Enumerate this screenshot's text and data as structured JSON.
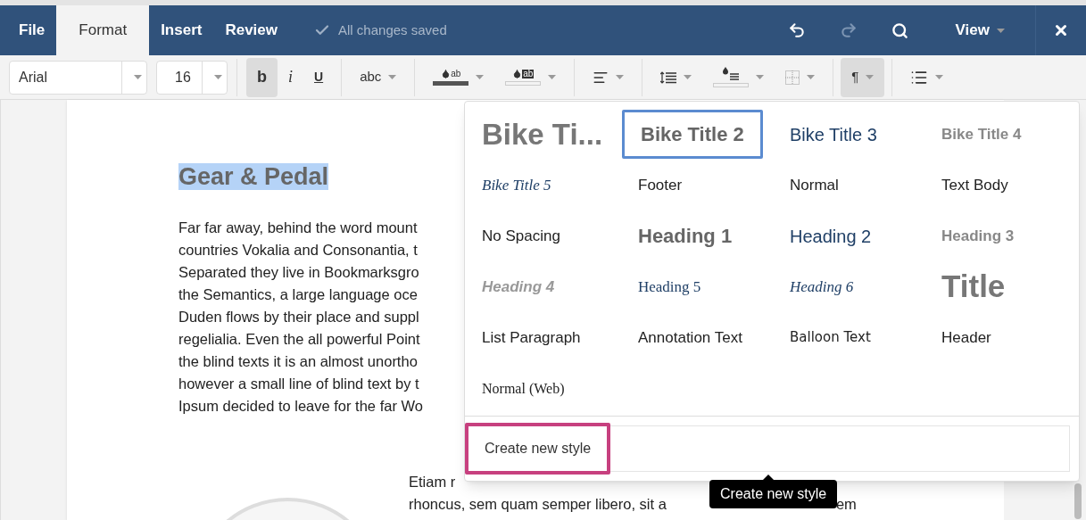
{
  "menu_tabs": [
    {
      "label": "File",
      "selected": false
    },
    {
      "label": "Format",
      "selected": true
    },
    {
      "label": "Insert",
      "selected": false
    },
    {
      "label": "Review",
      "selected": false
    }
  ],
  "save_status": "All changes saved",
  "top_actions": [
    {
      "kind": "undo",
      "disabled": false
    },
    {
      "kind": "redo",
      "disabled": true
    },
    {
      "kind": "search",
      "disabled": false
    }
  ],
  "view_menu": "View",
  "toolbar": {
    "font": "Arial",
    "size": "16",
    "buttons": [
      {
        "kind": "bold",
        "label": "b",
        "active": true,
        "dropdown": false
      },
      {
        "kind": "italic",
        "label": "i",
        "active": false,
        "dropdown": false
      },
      {
        "kind": "underline",
        "label": "U",
        "active": false,
        "dropdown": false
      },
      {
        "kind": "text",
        "label": "abc",
        "active": false,
        "dropdown": true
      },
      {
        "kind": "font-color",
        "label": "ab",
        "active": false,
        "dropdown": true
      },
      {
        "kind": "highlight",
        "label": "ab",
        "active": false,
        "dropdown": true
      },
      {
        "kind": "align",
        "active": false,
        "dropdown": true
      },
      {
        "kind": "line-spacing",
        "active": false,
        "dropdown": true
      },
      {
        "kind": "shading",
        "active": false,
        "dropdown": true
      },
      {
        "kind": "borders",
        "active": false,
        "dropdown": true
      },
      {
        "kind": "text",
        "label": "¶",
        "active": true,
        "dropdown": true
      },
      {
        "kind": "list",
        "active": false,
        "dropdown": true
      }
    ]
  },
  "document": {
    "heading": "Gear & Pedal",
    "paragraph": [
      "Far far away, behind the word mount",
      "countries Vokalia and Consonantia, t",
      "Separated they live in Bookmarksgro",
      "the Semantics, a large language oce",
      "Duden flows by their place and suppl",
      "regelialia. Even the all powerful Point",
      "the blind texts it is an almost unortho",
      "however a small line of blind text by t",
      "Ipsum decided to leave for the far Wo"
    ],
    "paragraph_2": [
      "Etiam r",
      "rhoncus, sem quam semper libero, sit a"
    ],
    "paragraph_2_tail": "em"
  },
  "styles_menu": {
    "items": [
      {
        "label": "Bike Ti...",
        "kind": "bike-title-1",
        "selected": false
      },
      {
        "label": "Bike Title 2",
        "kind": "bike-title-2",
        "selected": true
      },
      {
        "label": "Bike Title 3",
        "kind": "bike-title-3",
        "selected": false
      },
      {
        "label": "Bike Title 4",
        "kind": "bike-title-4",
        "selected": false
      },
      {
        "label": "Bike Title 5",
        "kind": "bike-title-5",
        "selected": false
      },
      {
        "label": "Footer",
        "kind": "plain",
        "selected": false
      },
      {
        "label": "Normal",
        "kind": "plain",
        "selected": false
      },
      {
        "label": "Text Body",
        "kind": "plain",
        "selected": false
      },
      {
        "label": "No Spacing",
        "kind": "plain",
        "selected": false
      },
      {
        "label": "Heading 1",
        "kind": "heading-1",
        "selected": false
      },
      {
        "label": "Heading 2",
        "kind": "heading-2",
        "selected": false
      },
      {
        "label": "Heading 3",
        "kind": "heading-3",
        "selected": false
      },
      {
        "label": "Heading 4",
        "kind": "heading-4",
        "selected": false
      },
      {
        "label": "Heading 5",
        "kind": "heading-5",
        "selected": false
      },
      {
        "label": "Heading 6",
        "kind": "heading-6",
        "selected": false
      },
      {
        "label": "Title",
        "kind": "title",
        "selected": false
      },
      {
        "label": "List Paragraph",
        "kind": "plain",
        "selected": false
      },
      {
        "label": "Annotation Text",
        "kind": "plain",
        "selected": false
      },
      {
        "label": "Balloon Text",
        "kind": "balloon",
        "selected": false
      },
      {
        "label": "Header",
        "kind": "plain",
        "selected": false
      },
      {
        "label": "Normal (Web)",
        "kind": "serif-plain",
        "selected": false
      }
    ],
    "create_button": "Create new style",
    "tooltip": "Create new style"
  }
}
